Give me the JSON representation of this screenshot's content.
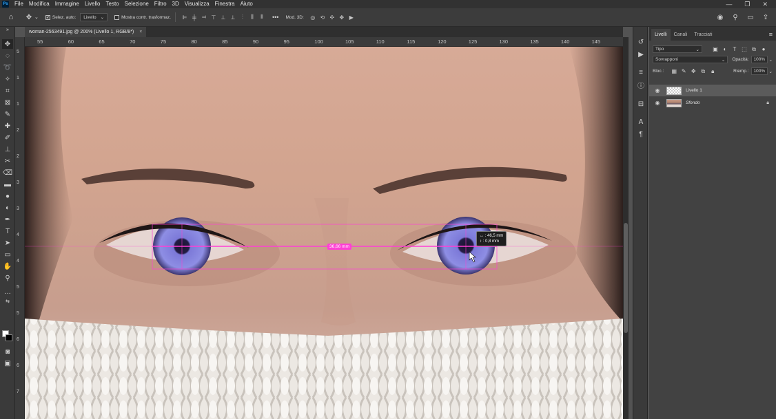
{
  "app": {
    "logo": "Ps"
  },
  "menu": [
    "File",
    "Modifica",
    "Immagine",
    "Livello",
    "Testo",
    "Selezione",
    "Filtro",
    "3D",
    "Visualizza",
    "Finestra",
    "Aiuto"
  ],
  "window_controls": [
    "—",
    "❐",
    "✕"
  ],
  "options": {
    "auto_select_label": "Selez. auto:",
    "auto_select_checked": true,
    "auto_select_value": "Livello",
    "show_transform_label": "Mostra contr. trasformaz.",
    "show_transform_checked": false,
    "mode_3d_label": "Mod. 3D:",
    "more": "•••"
  },
  "document": {
    "tab_title": "woman-2563491.jpg @ 200% (Livello 1, RGB/8*)",
    "close_glyph": "×"
  },
  "ruler": {
    "top_ticks": [
      "55",
      "60",
      "65",
      "70",
      "75",
      "80",
      "85",
      "90",
      "95",
      "100",
      "105",
      "110",
      "115",
      "120",
      "125",
      "130",
      "135",
      "140",
      "145"
    ],
    "left_ticks": [
      "5",
      "1",
      "1",
      "2",
      "2",
      "3",
      "3",
      "4",
      "4",
      "5",
      "5",
      "6",
      "6",
      "7"
    ]
  },
  "measure": {
    "distance_label": "36,66 mm",
    "dx_label": "↔ :",
    "dx_value": "46,5 mm",
    "dy_label": "↕ :",
    "dy_value": "0,8 mm"
  },
  "layers_panel": {
    "tabs": [
      "Livelli",
      "Canali",
      "Tracciati"
    ],
    "filter_value": "Tipo",
    "blend_mode": "Sovrapponi",
    "opacity_label": "Opacità:",
    "opacity_value": "100%",
    "lock_label": "Bloc.:",
    "fill_label": "Riemp.:",
    "fill_value": "100%",
    "layers": [
      {
        "name": "Livello 1",
        "selected": true,
        "locked": false
      },
      {
        "name": "Sfondo",
        "selected": false,
        "locked": true
      }
    ]
  },
  "colors": {
    "measure_accent": "#ff3fd5",
    "selection_highlight": "#5b5b5b"
  }
}
